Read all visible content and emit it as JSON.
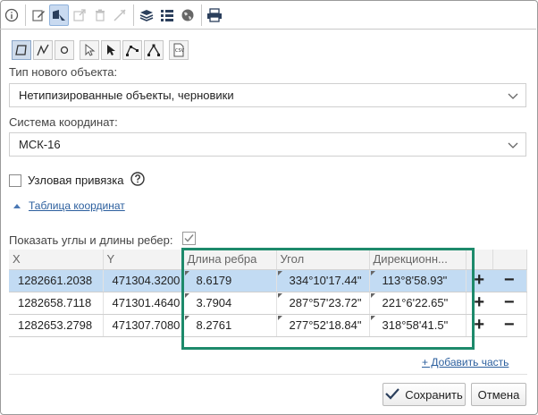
{
  "toolbar": {
    "icons": [
      "info-icon",
      "edit-icon",
      "select-object-icon",
      "export-icon",
      "delete-icon",
      "measure-icon",
      "layers-icon",
      "list-icon",
      "globe-icon",
      "print-icon"
    ]
  },
  "geometry_tools": [
    "polygon-icon",
    "polyline-icon",
    "point-icon",
    "pointer-icon",
    "select-arrow-icon",
    "vertex-edit-icon",
    "vertex-move-icon",
    "csv-import-icon"
  ],
  "form": {
    "object_type_label": "Тип нового объекта:",
    "object_type_value": "Нетипизированные объекты, черновики",
    "coord_system_label": "Система координат:",
    "coord_system_value": "МСК-16",
    "snap_label": "Узловая привязка",
    "coord_table_link": "Таблица координат",
    "show_angles_label": "Показать углы и длины ребер:"
  },
  "table": {
    "headers": [
      "X",
      "Y",
      "Длина ребра",
      "Угол",
      "Дирекционн..."
    ],
    "rows": [
      {
        "x": "1282661.2038",
        "y": "471304.3200",
        "len": "8.6179",
        "angle": "334°10'17.44\"",
        "dir": "113°8'58.93\"",
        "selected": true
      },
      {
        "x": "1282658.7118",
        "y": "471301.4640",
        "len": "3.7904",
        "angle": "287°57'23.72\"",
        "dir": "221°6'22.65\"",
        "selected": false
      },
      {
        "x": "1282653.2798",
        "y": "471307.7080",
        "len": "8.2761",
        "angle": "277°52'18.84\"",
        "dir": "318°58'41.5\"",
        "selected": false
      }
    ],
    "add_symbol": "+",
    "remove_symbol": "−"
  },
  "add_part_link": "+ Добавить часть",
  "buttons": {
    "save": "Сохранить",
    "cancel": "Отмена"
  },
  "colors": {
    "highlight": "#1d8a6b",
    "selected_row": "#c2dbf3",
    "link": "#2c5f9e"
  }
}
